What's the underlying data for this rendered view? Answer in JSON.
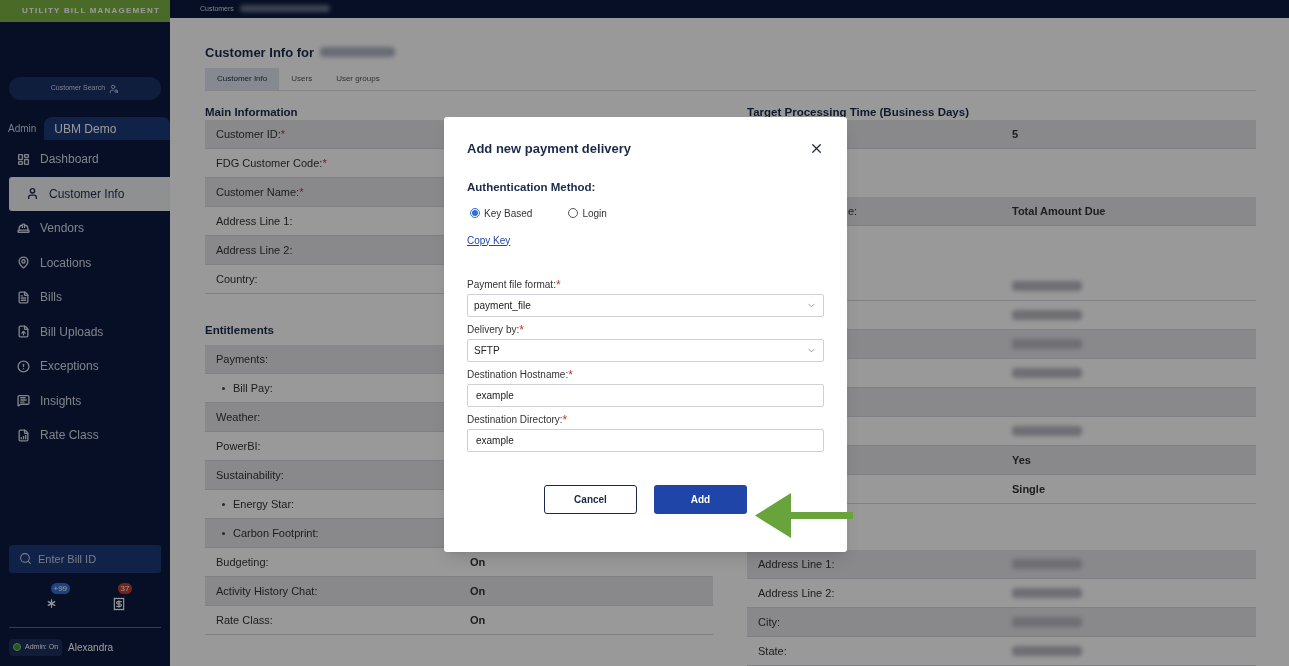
{
  "top_bar": {
    "logo_text": "UTILITY BILL MANAGEMENT",
    "breadcrumb": "Customers"
  },
  "sidebar": {
    "customer_search": "Customer Search",
    "tabs": [
      {
        "label": "Admin",
        "selected": false
      },
      {
        "label": "UBM Demo",
        "selected": true
      }
    ],
    "items": [
      {
        "label": "Dashboard",
        "selected": false
      },
      {
        "label": "Customer Info",
        "selected": true
      },
      {
        "label": "Vendors",
        "selected": false
      },
      {
        "label": "Locations",
        "selected": false
      },
      {
        "label": "Bills",
        "selected": false
      },
      {
        "label": "Bill Uploads",
        "selected": false
      },
      {
        "label": "Exceptions",
        "selected": false
      },
      {
        "label": "Insights",
        "selected": false
      },
      {
        "label": "Rate Class",
        "selected": false
      }
    ],
    "bill_search": {
      "placeholder": "Enter Bill ID"
    },
    "notifications": [
      {
        "kind": "asterisk",
        "badge": "+99"
      },
      {
        "kind": "bill",
        "badge": "37"
      }
    ],
    "admin_toggle": {
      "label": "Admin: On",
      "on": true
    },
    "user": "Alexandra"
  },
  "page": {
    "title": "Customer Info for",
    "tabs": [
      {
        "label": "Customer Info",
        "selected": true
      },
      {
        "label": "Users",
        "selected": false
      },
      {
        "label": "User groups",
        "selected": false
      }
    ],
    "main_information": {
      "heading": "Main Information",
      "rows": [
        {
          "label": "Customer ID:",
          "required_mark": "*"
        },
        {
          "label": "FDG Customer Code:",
          "required_mark": "*"
        },
        {
          "label": "Customer Name:",
          "required_mark": "*"
        },
        {
          "label": "Address Line 1:"
        },
        {
          "label": "Address Line 2:"
        },
        {
          "label": "Country:"
        }
      ]
    },
    "entitlements": {
      "heading": "Entitlements",
      "rows": [
        {
          "label": "Payments:",
          "sub": false
        },
        {
          "label": "Bill Pay:",
          "sub": true
        },
        {
          "label": "Weather:",
          "sub": false
        },
        {
          "label": "PowerBI:",
          "sub": false
        },
        {
          "label": "Sustainability:",
          "sub": false
        },
        {
          "label": "Energy Star:",
          "sub": true
        },
        {
          "label": "Carbon Footprint:",
          "sub": true
        },
        {
          "label": "Budgeting:",
          "sub": false,
          "value": "On"
        },
        {
          "label": "Activity History Chat:",
          "sub": false,
          "value": "On"
        },
        {
          "label": "Rate Class:",
          "sub": false,
          "value": "On"
        }
      ]
    },
    "target_processing": {
      "heading": "Target Processing Time (Business Days)",
      "rows": [
        {
          "kind": "row",
          "shaded": true,
          "value": "5"
        },
        {
          "kind": "gap"
        },
        {
          "kind": "row",
          "shaded": true,
          "label": "e:",
          "value": "Total Amount Due"
        },
        {
          "kind": "break"
        },
        {
          "kind": "row",
          "shaded": false,
          "redacted": true
        },
        {
          "kind": "row",
          "shaded": false,
          "redacted": true
        },
        {
          "kind": "row",
          "shaded": true,
          "redacted": true
        },
        {
          "kind": "row",
          "shaded": false,
          "redacted": true
        },
        {
          "kind": "row",
          "shaded": true
        },
        {
          "kind": "row",
          "shaded": false,
          "redacted": true
        },
        {
          "kind": "row",
          "shaded": true,
          "value": "Yes"
        },
        {
          "kind": "row",
          "shaded": false,
          "value": "Single"
        },
        {
          "kind": "break"
        },
        {
          "kind": "row",
          "shaded": true,
          "label": "Address Line 1:",
          "redacted": true
        },
        {
          "kind": "row",
          "shaded": false,
          "label": "Address Line 2:",
          "redacted": true
        },
        {
          "kind": "row",
          "shaded": true,
          "label": "City:",
          "redacted": true
        },
        {
          "kind": "row",
          "shaded": false,
          "label": "State:",
          "redacted": true
        }
      ]
    }
  },
  "dialog": {
    "title": "Add new payment delivery",
    "auth_label": "Authentication Method:",
    "auth_options": [
      {
        "label": "Key Based",
        "selected": true
      },
      {
        "label": "Login",
        "selected": false
      }
    ],
    "copy_key": "Copy Key",
    "fields": [
      {
        "kind": "select",
        "label": "Payment file format:",
        "required_mark": "*",
        "value": "payment_file"
      },
      {
        "kind": "select",
        "label": "Delivery by:",
        "required_mark": "*",
        "value": "SFTP"
      },
      {
        "kind": "text",
        "label": "Destination Hostname:",
        "required_mark": "*",
        "value": "example"
      },
      {
        "kind": "text",
        "label": "Destination Directory:",
        "required_mark": "*",
        "value": "example"
      }
    ],
    "buttons": [
      {
        "label": "Cancel",
        "kind": "secondary"
      },
      {
        "label": "Add",
        "kind": "primary"
      }
    ]
  }
}
